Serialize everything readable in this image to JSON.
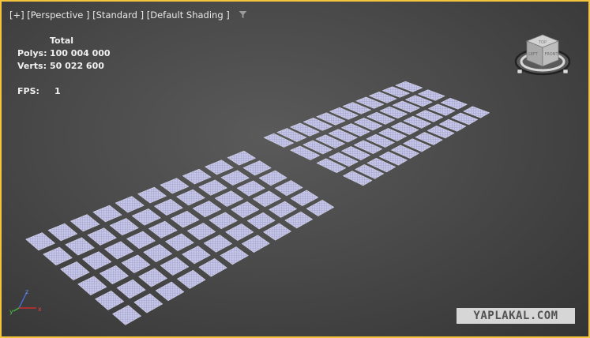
{
  "viewport": {
    "label": "[+] [Perspective ] [Standard ] [Default Shading ]",
    "filter_icon": "funnel-icon",
    "active_border_color": "#f2c53d"
  },
  "stats": {
    "header": "Total",
    "polys_label": "Polys:",
    "polys_value": "100 004 000",
    "verts_label": "Verts:",
    "verts_value": "50 022 600",
    "fps_label": "FPS:",
    "fps_value": "1"
  },
  "viewcube": {
    "icon": "viewcube-icon",
    "face_labels": [
      "TOP",
      "LEFT",
      "FRONT"
    ]
  },
  "axis_tripod": {
    "icon": "axis-tripod-icon",
    "labels": [
      "x",
      "y",
      "z"
    ]
  },
  "scene": {
    "object_color": "#c6c6e8",
    "grid_line_color": "#8a8ab8"
  },
  "watermark": "YAPLAKAL.COM"
}
